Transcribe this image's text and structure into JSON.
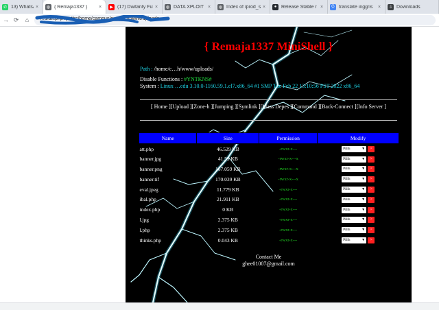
{
  "browser": {
    "tabs": [
      {
        "label": "13) WhatsApp",
        "icon": "whatsapp-icon",
        "color": "#25d366"
      },
      {
        "label": "{ Remaja1337 }",
        "icon": "globe-icon",
        "color": "#5f6368",
        "active": true
      },
      {
        "label": "(17) Dwitanty Ful",
        "icon": "youtube-icon",
        "color": "#ff0000"
      },
      {
        "label": "DATA XPLOIT",
        "icon": "globe-icon",
        "color": "#5f6368"
      },
      {
        "label": "Index of /prod_s",
        "icon": "globe-icon",
        "color": "#5f6368"
      },
      {
        "label": "Release Stable r",
        "icon": "github-icon",
        "color": "#24292f"
      },
      {
        "label": "translate inggris",
        "icon": "google-icon",
        "color": "#4285f4"
      },
      {
        "label": "Downloads",
        "icon": "download-icon",
        "color": "#3c4043"
      }
    ],
    "url": "…s/att.php?path=/home/campus/outreach/www/uploads"
  },
  "shell": {
    "title": "{ Remaja1337 MiniShell }",
    "path_label": "Path :",
    "path_value": "/home/c…h/www/uploads/",
    "disable_label": "Disable Functions :",
    "disable_value": "#YNTKNS#",
    "system_label": "System :",
    "system_value": "Linux …edu 3.10.0-1160.59.1.el7.x86_64 #1 SMP Tue Feb 22 13:10:56 PST 2022 x86_64",
    "menu": [
      "Home",
      "Upload",
      "Zone-h",
      "Jumping",
      "Symlink",
      "Mass Depes",
      "Command",
      "Back-Connect",
      "Info Server"
    ],
    "table": {
      "headers": [
        "Name",
        "Size",
        "Permission",
        "Modify"
      ],
      "rows": [
        {
          "name": "att.php",
          "size": "46.529 KB",
          "perm": "-rwxr-x---"
        },
        {
          "name": "banner.jpg",
          "size": "41.59 KB",
          "perm": "-rwxr-x---x"
        },
        {
          "name": "banner.png",
          "size": "167.059 KB",
          "perm": "-rwxr-x---x"
        },
        {
          "name": "banner.tif",
          "size": "170.039 KB",
          "perm": "-rwxr-x---x"
        },
        {
          "name": "eval.jpeg",
          "size": "11.779 KB",
          "perm": "-rwxr-x---"
        },
        {
          "name": "ibal.php",
          "size": "21.911 KB",
          "perm": "-rwxr-x---"
        },
        {
          "name": "index.php",
          "size": "0 KB",
          "perm": "-rwxr-x---"
        },
        {
          "name": "l.jpg",
          "size": "2.375 KB",
          "perm": "-rwxr-x---"
        },
        {
          "name": "l.php",
          "size": "2.375 KB",
          "perm": "-rwxr-x---"
        },
        {
          "name": "thinks.php",
          "size": "0.043 KB",
          "perm": "-rwxr-x---"
        }
      ],
      "select_label": "Pilih",
      "go_label": ">"
    },
    "contact_label": "Contact Me",
    "contact_email": "ghee01007@gmail.com"
  }
}
